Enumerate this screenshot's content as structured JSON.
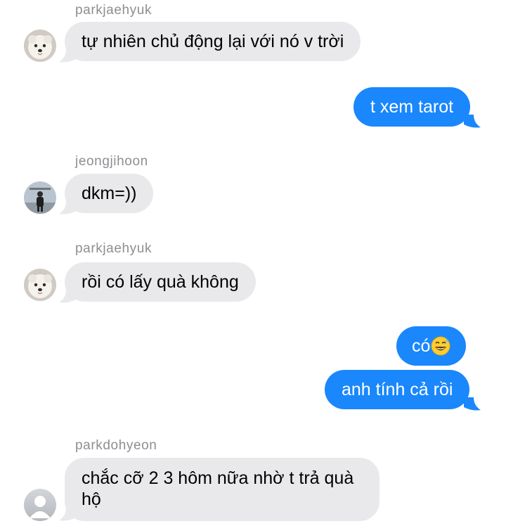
{
  "colors": {
    "incoming_bubble": "#e9e9eb",
    "outgoing_bubble": "#1a87fc",
    "sender_name": "#8e8e93"
  },
  "messages": [
    {
      "sender": "parkjaehyuk",
      "avatar": "pomeranian-dog-avatar",
      "text": "tự nhiên chủ động lại với nó v trời"
    },
    {
      "direction": "outgoing",
      "text": "t xem tarot"
    },
    {
      "sender": "jeongjihoon",
      "avatar": "person-photo-avatar",
      "text": "dkm=))"
    },
    {
      "sender": "parkjaehyuk",
      "avatar": "pomeranian-dog-avatar",
      "text": "rồi có lấy quà không"
    },
    {
      "direction": "outgoing",
      "text": "có",
      "emoji": "grinning-sweat-emoji"
    },
    {
      "direction": "outgoing",
      "text": "anh tính cả rồi"
    },
    {
      "sender": "parkdohyeon",
      "avatar": "default-person-avatar",
      "text": "chắc cỡ 2 3 hôm nữa nhờ t trả quà\nhộ"
    }
  ]
}
